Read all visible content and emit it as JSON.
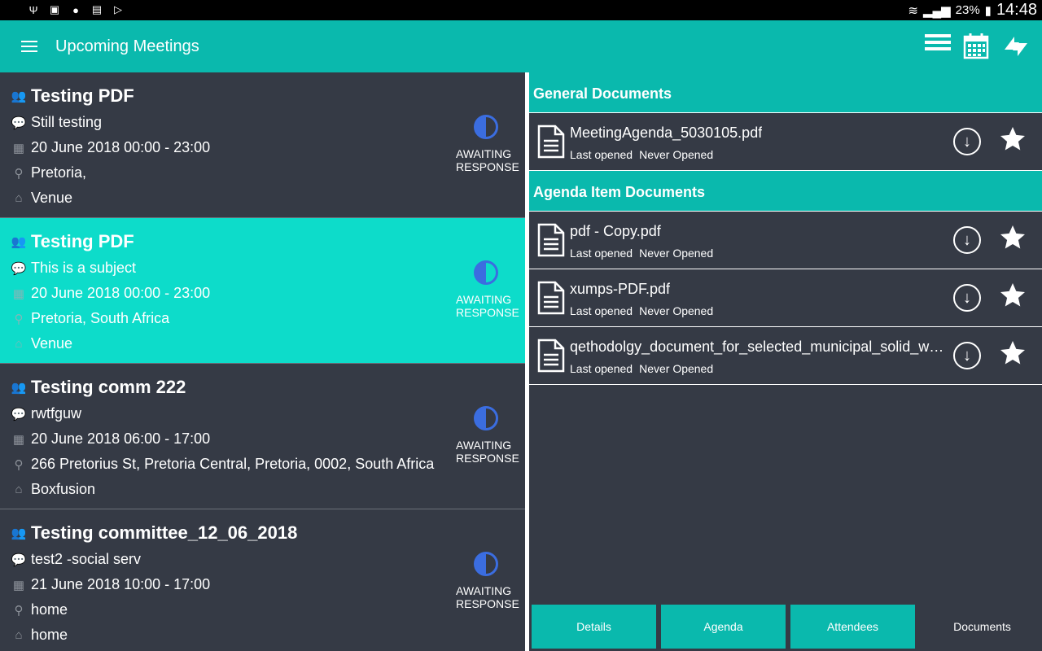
{
  "status_bar": {
    "icons": [
      "usb-icon",
      "image-icon",
      "globe-icon",
      "sim-icon",
      "play-store-icon"
    ],
    "battery": "23%",
    "time": "14:48"
  },
  "app_bar": {
    "title": "Upcoming Meetings",
    "actions": [
      "list-view-icon",
      "calendar-icon",
      "sync-icon"
    ]
  },
  "meetings": [
    {
      "title": "Testing PDF",
      "subject": "Still testing",
      "date": "20 June 2018 00:00  -  23:00",
      "location": "Pretoria,",
      "venue": "Venue",
      "status": "AWAITING RESPONSE"
    },
    {
      "title": "Testing PDF",
      "subject": "This is  a subject",
      "date": "20 June 2018 00:00  -  23:00",
      "location": "Pretoria, South Africa",
      "venue": "Venue",
      "status": "AWAITING RESPONSE"
    },
    {
      "title": "Testing comm 222",
      "subject": "rwtfguw",
      "date": "20 June 2018 06:00  -  17:00",
      "location": "266 Pretorius St, Pretoria Central, Pretoria, 0002, South Africa",
      "venue": "Boxfusion",
      "status": "AWAITING RESPONSE"
    },
    {
      "title": "Testing committee_12_06_2018",
      "subject": "test2 -social serv",
      "date": "21 June 2018 10:00  -  17:00",
      "location": "home",
      "venue": "home",
      "status": "AWAITING RESPONSE"
    }
  ],
  "documents": {
    "general_heading": "General Documents",
    "general": [
      {
        "name": "MeetingAgenda_5030105.pdf",
        "last_opened_label": "Last opened",
        "last_opened": "Never Opened"
      }
    ],
    "agenda_heading": "Agenda Item Documents",
    "agenda": [
      {
        "name": "pdf - Copy.pdf",
        "last_opened_label": "Last opened",
        "last_opened": "Never Opened"
      },
      {
        "name": "xumps-PDF.pdf",
        "last_opened_label": "Last opened",
        "last_opened": "Never Opened"
      },
      {
        "name": "qethodolgy_document_for_selected_municipal_solid_wa...",
        "last_opened_label": "Last opened",
        "last_opened": "Never Opened"
      }
    ]
  },
  "tabs": [
    {
      "label": "Details",
      "active": false
    },
    {
      "label": "Agenda",
      "active": false
    },
    {
      "label": "Attendees",
      "active": false
    },
    {
      "label": "Documents",
      "active": true
    }
  ],
  "colors": {
    "teal": "#0ab9ad",
    "selected": "#0ddcca",
    "background": "#353a45",
    "status_icon": "#3b6de0"
  }
}
